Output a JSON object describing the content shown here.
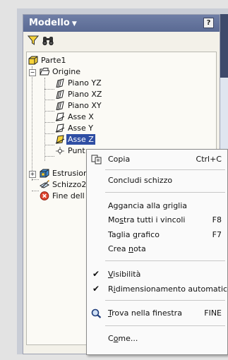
{
  "panel": {
    "title": "Modello",
    "help_label": "?"
  },
  "tree": {
    "root": "Parte1",
    "origin": "Origine",
    "items": [
      "Piano YZ",
      "Piano XZ",
      "Piano XY",
      "Asse X",
      "Asse Y",
      "Asse Z",
      "Punt"
    ],
    "extrusion": "Estrusion",
    "sketch": "Schizzo2",
    "end": "Fine dell"
  },
  "context_menu": {
    "copy": "Copia",
    "copy_shortcut": "Ctrl+C",
    "finish_sketch": "Concludi schizzo",
    "snap_grid": "Aggancia alla griglia",
    "show_constraints_a": "Mo",
    "show_constraints_u": "s",
    "show_constraints_b": "tra tutti i vincoli",
    "show_constraints_shortcut": "F8",
    "slice_a": "Taglia ",
    "slice_u": "g",
    "slice_b": "rafico",
    "slice_shortcut": "F7",
    "note_a": "Crea ",
    "note_u": "n",
    "note_b": "ota",
    "visibility_u": "V",
    "visibility_b": "isibilità",
    "autoresize_a": "R",
    "autoresize_u": "i",
    "autoresize_b": "dimensionamento automatico",
    "find_u": "T",
    "find_b": "rova nella finestra",
    "find_shortcut": "FINE",
    "how_a": "C",
    "how_u": "o",
    "how_b": "me..."
  },
  "colors": {
    "selection": "#2f4ea3",
    "title_bar": "#5a6a93"
  }
}
